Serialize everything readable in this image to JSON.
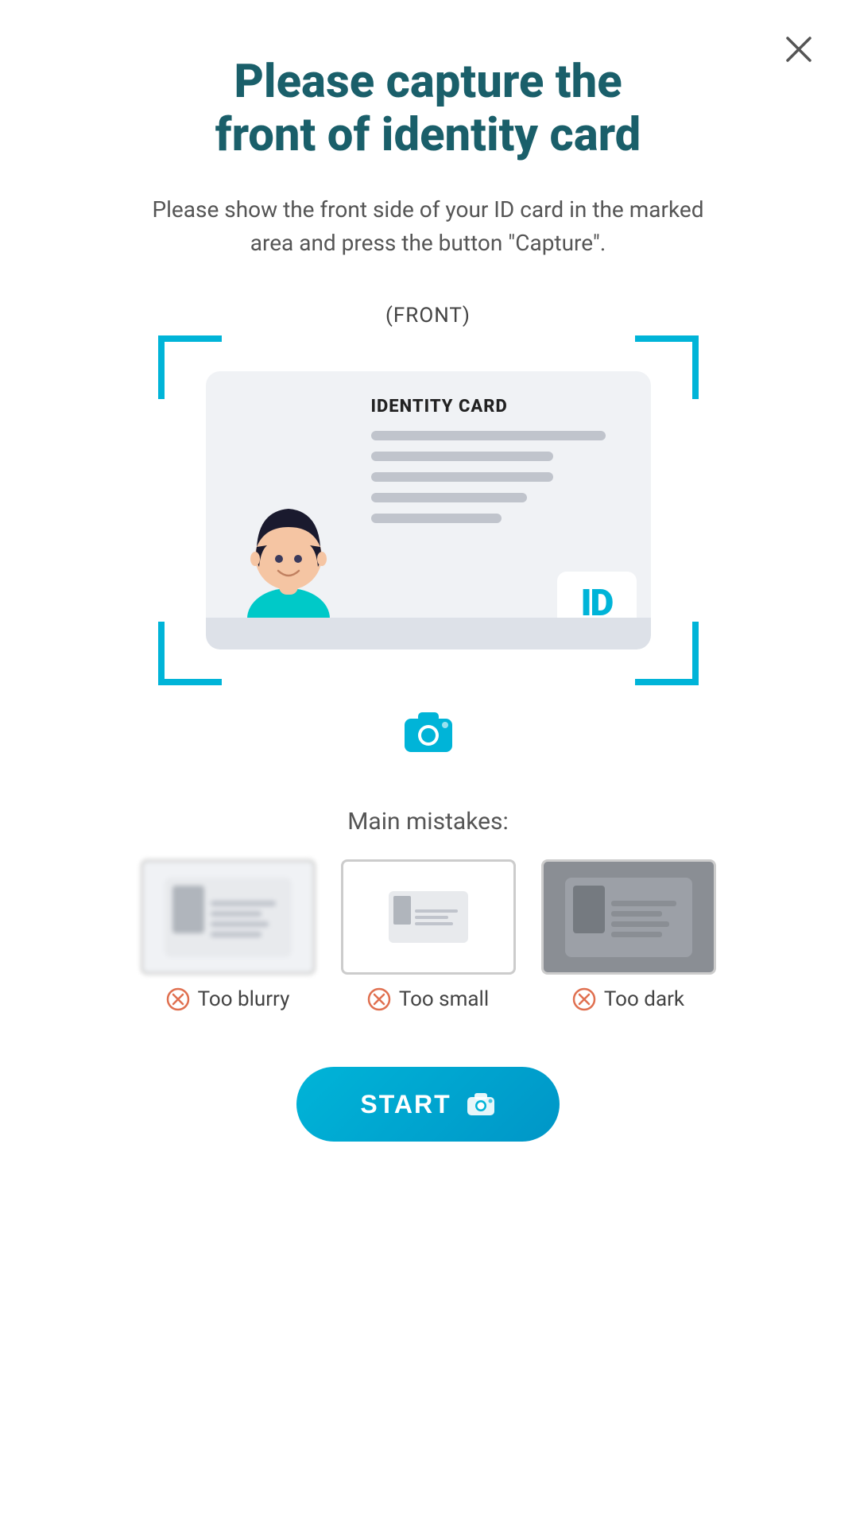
{
  "header": {
    "title_line1": "Please capture the",
    "title_line2": "front of identity card",
    "subtitle": "Please show the front side of your ID card in the marked area and press the button \"Capture\"."
  },
  "capture_area": {
    "front_label": "(FRONT)",
    "card": {
      "title": "IDENTITY CARD",
      "id_badge": "ID"
    }
  },
  "mistakes": {
    "section_title": "Main mistakes:",
    "items": [
      {
        "label": "Too blurry"
      },
      {
        "label": "Too small"
      },
      {
        "label": "Too dark"
      }
    ]
  },
  "start_button": {
    "label": "START"
  },
  "close_button": {
    "label": "Close"
  }
}
